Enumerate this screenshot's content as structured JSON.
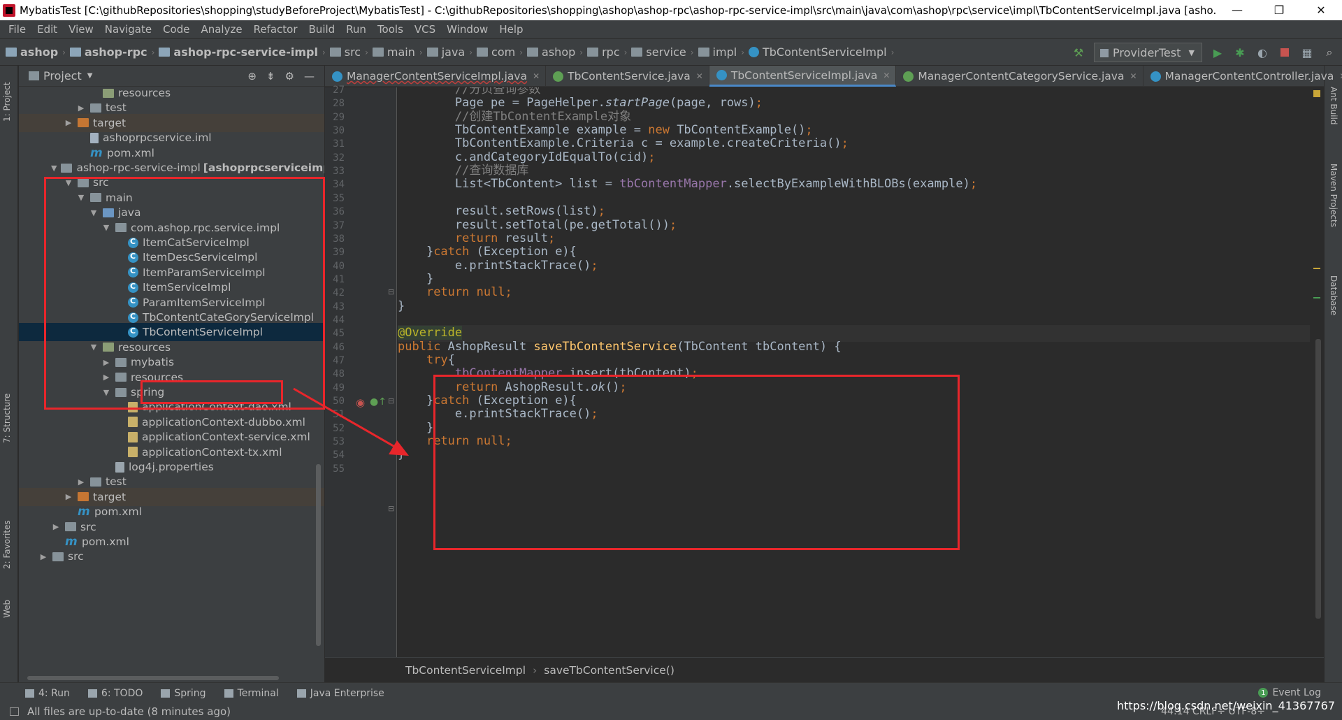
{
  "window": {
    "title": "MybatisTest [C:\\githubRepositories\\shopping\\studyBeforeProject\\MybatisTest] - C:\\githubRepositories\\shopping\\ashop\\ashop-rpc\\ashop-rpc-service-impl\\src\\main\\java\\com\\ashop\\rpc\\service\\impl\\TbContentServiceImpl.java [asho...",
    "minimize": "—",
    "restore": "❐",
    "close": "✕"
  },
  "menu": [
    "File",
    "Edit",
    "View",
    "Navigate",
    "Code",
    "Analyze",
    "Refactor",
    "Build",
    "Run",
    "Tools",
    "VCS",
    "Window",
    "Help"
  ],
  "nav": {
    "crumbs": [
      "ashop",
      "ashop-rpc",
      "ashop-rpc-service-impl",
      "src",
      "main",
      "java",
      "com",
      "ashop",
      "rpc",
      "service",
      "impl",
      "TbContentServiceImpl"
    ],
    "run_config": "ProviderTest"
  },
  "left_strip": {
    "project": "1: Project",
    "structure": "7: Structure",
    "favorites": "2: Favorites",
    "web": "Web"
  },
  "right_strip": {
    "ant": "Ant Build",
    "maven": "Maven Projects",
    "database": "Database"
  },
  "project_panel": {
    "title": "Project",
    "tree": [
      {
        "label": "resources",
        "indent": 5,
        "icon": "res",
        "tw": ""
      },
      {
        "label": "test",
        "indent": 4,
        "icon": "folder",
        "tw": "▶"
      },
      {
        "label": "target",
        "indent": 3,
        "icon": "target",
        "tw": "▶",
        "hl": true
      },
      {
        "label": "ashoprpcservice.iml",
        "indent": 4,
        "icon": "iml",
        "tw": ""
      },
      {
        "label": "pom.xml",
        "indent": 4,
        "icon": "mvn",
        "tw": ""
      },
      {
        "label": "ashop-rpc-service-impl",
        "bold": "[ashoprpcserviceimpl]",
        "indent": 2,
        "icon": "folder",
        "tw": "▼"
      },
      {
        "label": "src",
        "indent": 3,
        "icon": "folder",
        "tw": "▼"
      },
      {
        "label": "main",
        "indent": 4,
        "icon": "folder",
        "tw": "▼"
      },
      {
        "label": "java",
        "indent": 5,
        "icon": "src",
        "tw": "▼"
      },
      {
        "label": "com.ashop.rpc.service.impl",
        "indent": 6,
        "icon": "folder",
        "tw": "▼"
      },
      {
        "label": "ItemCatServiceImpl",
        "indent": 7,
        "icon": "cls",
        "tw": ""
      },
      {
        "label": "ItemDescServiceImpl",
        "indent": 7,
        "icon": "cls",
        "tw": ""
      },
      {
        "label": "ItemParamServiceImpl",
        "indent": 7,
        "icon": "cls",
        "tw": ""
      },
      {
        "label": "ItemServiceImpl",
        "indent": 7,
        "icon": "cls",
        "tw": ""
      },
      {
        "label": "ParamItemServiceImpl",
        "indent": 7,
        "icon": "cls",
        "tw": ""
      },
      {
        "label": "TbContentCateGoryServiceImpl",
        "indent": 7,
        "icon": "cls",
        "tw": ""
      },
      {
        "label": "TbContentServiceImpl",
        "indent": 7,
        "icon": "cls",
        "tw": "",
        "sel": true
      },
      {
        "label": "resources",
        "indent": 5,
        "icon": "res",
        "tw": "▼"
      },
      {
        "label": "mybatis",
        "indent": 6,
        "icon": "folder",
        "tw": "▶"
      },
      {
        "label": "resources",
        "indent": 6,
        "icon": "folder",
        "tw": "▶"
      },
      {
        "label": "spring",
        "indent": 6,
        "icon": "folder",
        "tw": "▼"
      },
      {
        "label": "applicationContext-dao.xml",
        "indent": 7,
        "icon": "xml",
        "tw": ""
      },
      {
        "label": "applicationContext-dubbo.xml",
        "indent": 7,
        "icon": "xml",
        "tw": ""
      },
      {
        "label": "applicationContext-service.xml",
        "indent": 7,
        "icon": "xml",
        "tw": ""
      },
      {
        "label": "applicationContext-tx.xml",
        "indent": 7,
        "icon": "xml",
        "tw": ""
      },
      {
        "label": "log4j.properties",
        "indent": 6,
        "icon": "prop",
        "tw": ""
      },
      {
        "label": "test",
        "indent": 4,
        "icon": "folder",
        "tw": "▶"
      },
      {
        "label": "target",
        "indent": 3,
        "icon": "target",
        "tw": "▶",
        "hl": true
      },
      {
        "label": "pom.xml",
        "indent": 3,
        "icon": "mvn",
        "tw": ""
      },
      {
        "label": "src",
        "indent": 2,
        "icon": "folder",
        "tw": "▶"
      },
      {
        "label": "pom.xml",
        "indent": 2,
        "icon": "mvn",
        "tw": ""
      },
      {
        "label": "src",
        "indent": 1,
        "icon": "folder",
        "tw": "▶"
      }
    ]
  },
  "tabs": [
    {
      "label": "ManagerContentServiceImpl.java",
      "icon": "class",
      "err": true,
      "active": false
    },
    {
      "label": "TbContentService.java",
      "icon": "interface",
      "err": false,
      "active": false
    },
    {
      "label": "TbContentServiceImpl.java",
      "icon": "class",
      "err": false,
      "active": true
    },
    {
      "label": "ManagerContentCategoryService.java",
      "icon": "interface",
      "err": false,
      "active": false
    },
    {
      "label": "ManagerContentController.java",
      "icon": "class",
      "err": false,
      "active": false
    }
  ],
  "editor": {
    "line_numbers": [
      "27",
      "28",
      "29",
      "30",
      "31",
      "32",
      "33",
      "34",
      "35",
      "36",
      "37",
      "38",
      "39",
      "40",
      "41",
      "42",
      "43",
      "44",
      "45",
      "46",
      "47",
      "48",
      "49",
      "50",
      "51",
      "52",
      "53",
      "54",
      "55"
    ],
    "current_line": 18,
    "lines": [
      [
        [
          "",
          "        "
        ],
        [
          "cm",
          "//分页查询参数"
        ]
      ],
      [
        [
          "",
          "        Page pe = PageHelper."
        ],
        [
          "it",
          "startPage"
        ],
        [
          "",
          "(page, rows)"
        ],
        [
          "kw",
          ";"
        ]
      ],
      [
        [
          "",
          "        "
        ],
        [
          "cm",
          "//创建TbContentExample对象"
        ]
      ],
      [
        [
          "",
          "        TbContentExample example = "
        ],
        [
          "kw",
          "new "
        ],
        [
          "",
          "TbContentExample()"
        ],
        [
          "kw",
          ";"
        ]
      ],
      [
        [
          "",
          "        TbContentExample.Criteria c = example.createCriteria()"
        ],
        [
          "kw",
          ";"
        ]
      ],
      [
        [
          "",
          "        c.andCategoryIdEqualTo(cid)"
        ],
        [
          "kw",
          ";"
        ]
      ],
      [
        [
          "",
          "        "
        ],
        [
          "cm",
          "//查询数据库"
        ]
      ],
      [
        [
          "",
          "        List<TbContent> list = "
        ],
        [
          "fld",
          "tbContentMapper"
        ],
        [
          "",
          ".selectByExampleWithBLOBs(example)"
        ],
        [
          "kw",
          ";"
        ]
      ],
      [
        [
          "",
          ""
        ]
      ],
      [
        [
          "",
          "        result.setRows(list)"
        ],
        [
          "kw",
          ";"
        ]
      ],
      [
        [
          "",
          "        result.setTotal(pe.getTotal())"
        ],
        [
          "kw",
          ";"
        ]
      ],
      [
        [
          "",
          "        "
        ],
        [
          "kw",
          "return "
        ],
        [
          "",
          "result"
        ],
        [
          "kw",
          ";"
        ]
      ],
      [
        [
          "",
          "    }"
        ],
        [
          "kw",
          "catch "
        ],
        [
          "",
          "(Exception e){"
        ]
      ],
      [
        [
          "",
          "        e.printStackTrace()"
        ],
        [
          "kw",
          ";"
        ]
      ],
      [
        [
          "",
          "    }"
        ]
      ],
      [
        [
          "",
          "    "
        ],
        [
          "kw",
          "return null;"
        ]
      ],
      [
        [
          "",
          "}"
        ]
      ],
      [
        [
          "",
          ""
        ]
      ],
      [
        [
          "ann",
          "@Override"
        ]
      ],
      [
        [
          "kw",
          "public "
        ],
        [
          "",
          "AshopResult "
        ],
        [
          "fn",
          "saveTbContentService"
        ],
        [
          "",
          "(TbContent tbContent) {"
        ]
      ],
      [
        [
          "",
          "    "
        ],
        [
          "kw",
          "try"
        ],
        [
          "",
          "{"
        ]
      ],
      [
        [
          "",
          "        "
        ],
        [
          "fld",
          "tbContentMapper"
        ],
        [
          "",
          ".insert(tbContent)"
        ],
        [
          "kw",
          ";"
        ]
      ],
      [
        [
          "",
          "        "
        ],
        [
          "kw",
          "return "
        ],
        [
          "",
          "AshopResult."
        ],
        [
          "it",
          "ok"
        ],
        [
          "",
          "()"
        ],
        [
          "kw",
          ";"
        ]
      ],
      [
        [
          "",
          "    }"
        ],
        [
          "kw",
          "catch "
        ],
        [
          "",
          "(Exception e){"
        ]
      ],
      [
        [
          "",
          "        e.printStackTrace()"
        ],
        [
          "kw",
          ";"
        ]
      ],
      [
        [
          "",
          "    }"
        ]
      ],
      [
        [
          "",
          "    "
        ],
        [
          "kw",
          "return null;"
        ]
      ],
      [
        [
          "",
          "}"
        ]
      ],
      [
        [
          "",
          ""
        ]
      ]
    ],
    "breadcrumb": [
      "TbContentServiceImpl",
      "saveTbContentService()"
    ]
  },
  "bottom_tools": [
    "4: Run",
    "6: TODO",
    "Spring",
    "Terminal",
    "Java Enterprise"
  ],
  "event_log": "Event Log",
  "status": {
    "message": "All files are up-to-date (8 minutes ago)",
    "position": "44:14  CRLF÷  UTF-8÷"
  },
  "watermark": "https://blog.csdn.net/weixin_41367767",
  "colors": {
    "annotation": "#e8262b",
    "keyword": "#cc7832",
    "field": "#9876aa",
    "method": "#ffc66d"
  }
}
